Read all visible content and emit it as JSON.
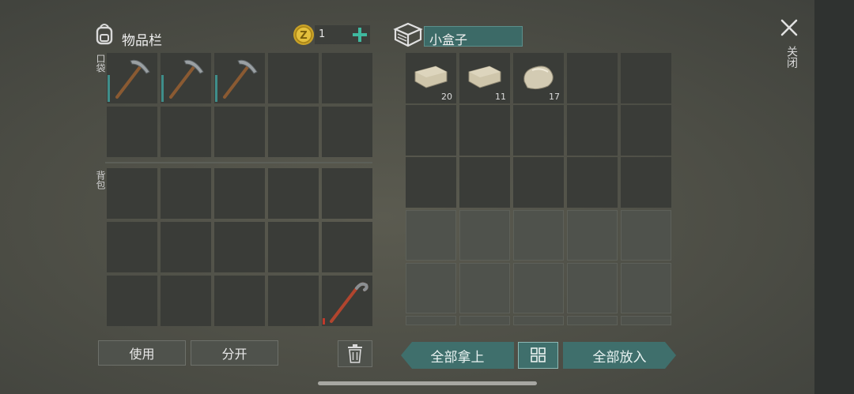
{
  "inventory": {
    "title": "物品栏",
    "coins": "1",
    "pocket_label": "口袋",
    "backpack_label": "背包"
  },
  "container": {
    "name_value": "小盒子"
  },
  "close": {
    "label": "关闭"
  },
  "buttons": {
    "use": "使用",
    "split": "分开",
    "take_all": "全部拿上",
    "put_all": "全部放入"
  },
  "container_items": [
    {
      "icon": "stone-icon",
      "count": "20"
    },
    {
      "icon": "stone-icon",
      "count": "11"
    },
    {
      "icon": "rock-icon",
      "count": "17"
    }
  ],
  "colors": {
    "accent_teal": "#3f6f6c",
    "durability_teal": "#3f8e8a",
    "durability_red": "#c0392b"
  }
}
